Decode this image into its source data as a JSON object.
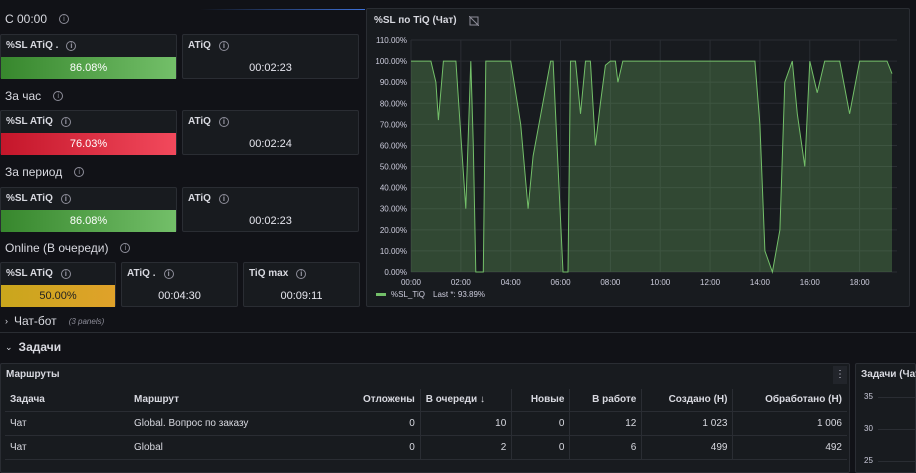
{
  "rows": {
    "today": "С 00:00",
    "hour": "За час",
    "period": "За период",
    "online": "Online (В очереди)"
  },
  "stats": {
    "today_sl_title": "%SL ATiQ .",
    "today_sl_value": "86.08%",
    "today_atiq_title": "ATiQ",
    "today_atiq_value": "00:02:23",
    "hour_sl_title": "%SL ATiQ",
    "hour_sl_value": "76.03%",
    "hour_atiq_title": "ATiQ",
    "hour_atiq_value": "00:02:24",
    "period_sl_title": "%SL ATiQ",
    "period_sl_value": "86.08%",
    "period_atiq_title": "ATiQ",
    "period_atiq_value": "00:02:23",
    "online_sl_title": "%SL ATiQ",
    "online_sl_value": "50.00%",
    "online_atiq_title": "ATiQ .",
    "online_atiq_value": "00:04:30",
    "online_tiq_title": "TiQ max",
    "online_tiq_value": "00:09:11"
  },
  "colors": {
    "green": "#73bf69",
    "red": "#f2495c",
    "yellow": "#e0a22a"
  },
  "chart_data": {
    "type": "area",
    "title": "%SL по TiQ (Чат)",
    "legend": "%SL_TiQ",
    "legend_last": "Last *: 93.89%",
    "yticks": [
      "110.00%",
      "100.00%",
      "90.00%",
      "80.00%",
      "70.00%",
      "60.00%",
      "50.00%",
      "40.00%",
      "30.00%",
      "20.00%",
      "10.00%",
      "0.00%"
    ],
    "xticks": [
      "00:00",
      "02:00",
      "04:00",
      "06:00",
      "08:00",
      "10:00",
      "12:00",
      "14:00",
      "16:00",
      "18:00"
    ],
    "ylim": [
      0,
      110
    ],
    "xlim_hours": [
      0,
      19.5
    ],
    "series": [
      {
        "x": [
          0,
          0.8,
          1,
          1.1,
          1.3,
          1.6,
          1.8,
          2,
          2.2,
          2.4,
          2.5,
          2.6,
          2.9,
          3,
          3.6,
          4,
          4.4,
          4.7,
          4.9,
          5.6,
          5.7,
          6.1,
          6.3,
          6.4,
          6.6,
          6.8,
          7,
          7.2,
          7.4,
          7.6,
          7.8,
          8,
          8.2,
          8.3,
          8.5,
          8.6,
          8.8,
          9,
          9.6,
          10,
          12,
          13.5,
          13.8,
          14,
          14.2,
          14.5,
          14.8,
          15,
          15.3,
          15.5,
          15.8,
          16,
          16.3,
          16.6,
          17,
          17.2,
          17.6,
          18,
          18.2,
          18.6,
          19.1,
          19.3
        ],
        "y": [
          100,
          100,
          90,
          72,
          100,
          100,
          100,
          65,
          30,
          100,
          60,
          0,
          0,
          100,
          100,
          100,
          70,
          30,
          55,
          100,
          100,
          0,
          0,
          100,
          100,
          75,
          100,
          100,
          60,
          80,
          98,
          100,
          100,
          90,
          100,
          100,
          100,
          100,
          100,
          100,
          100,
          100,
          100,
          70,
          10,
          0,
          20,
          90,
          100,
          75,
          50,
          100,
          85,
          100,
          100,
          100,
          75,
          100,
          100,
          100,
          100,
          94
        ]
      }
    ]
  },
  "chatbot": {
    "title": "Чат-бот",
    "sub": "(3 panels)"
  },
  "tasks": {
    "title": "Задачи"
  },
  "routes": {
    "title": "Маршруты",
    "columns": [
      "Задача",
      "Маршрут",
      "Отложены",
      "В очереди ↓",
      "Новые",
      "В работе",
      "Создано (Н)",
      "Обработано (Н)"
    ],
    "rows": [
      [
        "Чат",
        "Global. Вопрос по заказу",
        "0",
        "10",
        "0",
        "12",
        "1 023",
        "1 006"
      ],
      [
        "Чат",
        "Global",
        "0",
        "2",
        "0",
        "6",
        "499",
        "492"
      ]
    ]
  },
  "tasks_chart": {
    "title": "Задачи (Чат)",
    "yticks": [
      "35",
      "30",
      "25"
    ]
  }
}
